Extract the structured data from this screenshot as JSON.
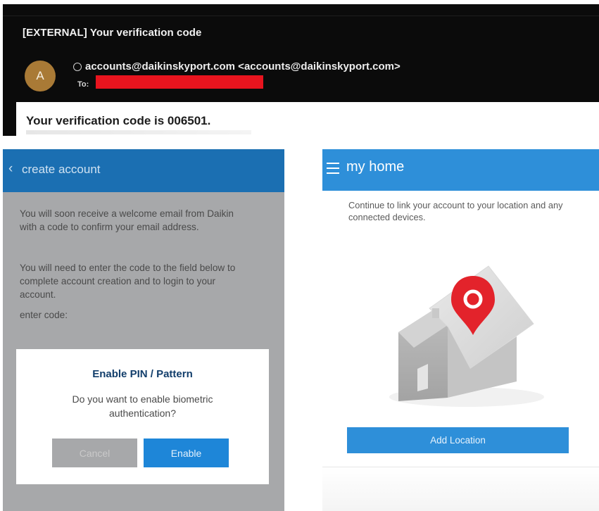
{
  "email": {
    "subject": "[EXTERNAL] Your verification code",
    "avatar_initial": "A",
    "sender": "accounts@daikinskyport.com <accounts@daikinskyport.com>",
    "to_label": "To:",
    "body_text": "Your verification code is 006501.",
    "redaction_color": "#e8141e"
  },
  "create_account": {
    "header_title": "create account",
    "back_icon": "chevron-left-icon",
    "paragraph_1": "You will soon receive a welcome email from Daikin with a code to confirm your email address.",
    "paragraph_2": "You will need to enter the code to the field below to complete account creation and to login to your account.",
    "enter_code_label": "enter code:",
    "dialog": {
      "title": "Enable PIN / Pattern",
      "message": "Do you want to enable biometric authentication?",
      "cancel_label": "Cancel",
      "enable_label": "Enable"
    },
    "colors": {
      "header": "#1b6fb2",
      "enable_button": "#1e86d8"
    }
  },
  "my_home": {
    "header_title": "my home",
    "menu_icon": "hamburger-menu-icon",
    "description": "Continue to link your account to your location and any connected devices.",
    "illustration_icon": "house-location-pin-icon",
    "add_location_label": "Add Location",
    "colors": {
      "header": "#2e8fd9",
      "pin": "#e3232b"
    }
  }
}
